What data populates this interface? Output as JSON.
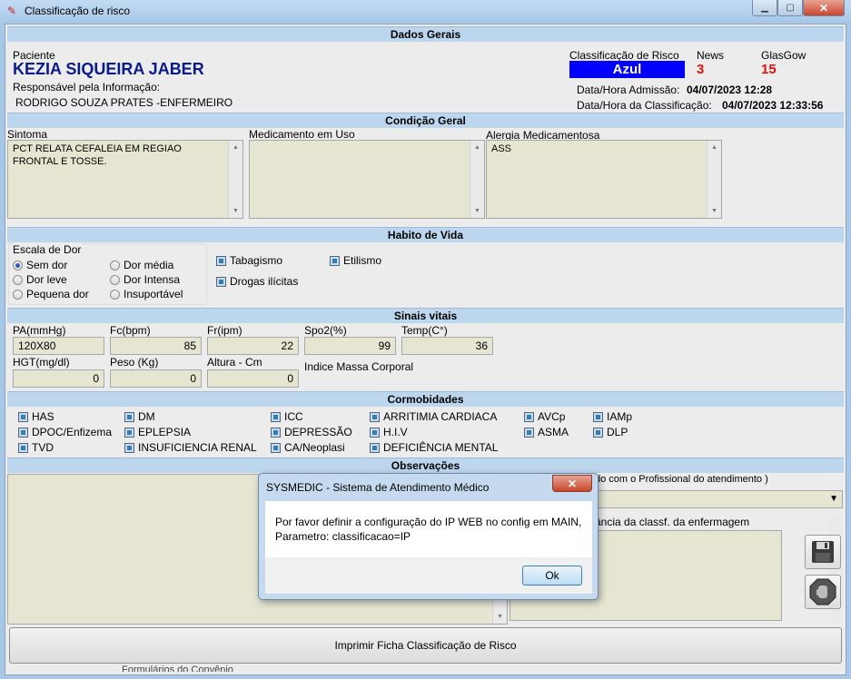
{
  "window": {
    "title": "Classificação de risco",
    "icon": "stethoscope-icon"
  },
  "sections": {
    "dados_gerais": "Dados Gerais",
    "condicao_geral": "Condição Geral",
    "habito_vida": "Habito de Vida",
    "sinais_vitais": "Sinais vitais",
    "cormobidades": "Cormobidades",
    "observacoes": "Observações"
  },
  "patient": {
    "label": "Paciente",
    "name": "KEZIA SIQUEIRA JABER",
    "responsible_label": "Responsável pela Informação:",
    "responsible": "RODRIGO SOUZA PRATES -ENFERMEIRO"
  },
  "risk": {
    "classification_label": "Classificação de Risco",
    "classification": "Azul",
    "classification_color": "#0000ff",
    "news_label": "News",
    "news": "3",
    "glasgow_label": "GlasGow",
    "glasgow": "15",
    "admission_label": "Data/Hora Admissão:",
    "admission": "04/07/2023 12:28",
    "classified_label": "Data/Hora da Classificação:",
    "classified": "04/07/2023 12:33:56"
  },
  "condition": {
    "symptom_label": "Sintoma",
    "symptom": "PCT RELATA CEFALEIA EM REGIAO FRONTAL E TOSSE.",
    "medication_label": "Medicamento em Uso",
    "medication": "",
    "allergy_label": "Alergia Medicamentosa",
    "allergy": "ASS"
  },
  "pain_scale": {
    "label": "Escala de Dor",
    "options": [
      "Sem dor",
      "Dor média",
      "Dor leve",
      "Dor Intensa",
      "Pequena dor",
      "Insuportável"
    ],
    "selected": "Sem dor"
  },
  "habits": {
    "tabagismo": "Tabagismo",
    "etilismo": "Etilismo",
    "drogas": "Drogas ilícitas"
  },
  "vitals": {
    "pa_label": "PA(mmHg)",
    "pa": "120X80",
    "fc_label": "Fc(bpm)",
    "fc": "85",
    "fr_label": "Fr(ipm)",
    "fr": "22",
    "spo2_label": "Spo2(%)",
    "spo2": "99",
    "temp_label": "Temp(C°)",
    "temp": "36",
    "hgt_label": "HGT(mg/dl)",
    "hgt": "0",
    "peso_label": "Peso (Kg)",
    "peso": "0",
    "altura_label": "Altura - Cm",
    "altura": "0",
    "imc_label": "Indice Massa Corporal"
  },
  "comorbidities": {
    "has": "HAS",
    "dpoc": "DPOC/Enfizema",
    "tvd": "TVD",
    "dm": "DM",
    "eplepsia": "EPLEPSIA",
    "insuf": "INSUFICIENCIA RENAL",
    "icc": "ICC",
    "depressao": "DEPRESSÃO",
    "ca": "CA/Neoplasi",
    "arritmia": "ARRITIMIA CARDIACA",
    "hiv": "H.I.V",
    "deficiencia": "DEFICIÊNCIA MENTAL",
    "avcp": "AVCp",
    "asma": "ASMA",
    "iamp": "IAMp",
    "dlp": "DLP"
  },
  "observations": {
    "partial_label_1": "do com o Profissional do atendimento )",
    "partial_label_2": "ância da classf. da enfermagem"
  },
  "print_button": "Imprimir Ficha Classificação de Risco",
  "bottom_partial": "Formulários do Convênio",
  "dialog": {
    "title": "SYSMEDIC - Sistema de Atendimento Médico",
    "line1": "Por favor definir a configuração do IP WEB no config em MAIN,",
    "line2": "Parametro: classificacao=IP",
    "ok": "Ok"
  }
}
